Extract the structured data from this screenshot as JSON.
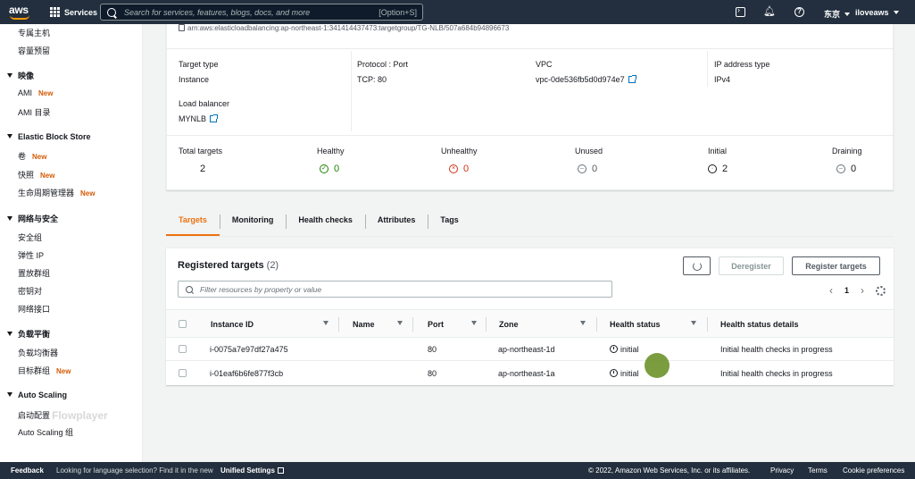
{
  "topnav": {
    "logo": "aws",
    "services": "Services",
    "search_placeholder": "Search for services, features, blogs, docs, and more",
    "search_shortcut": "[Option+S]",
    "region": "东京",
    "user": "iloveaws",
    "icons": [
      "cloudshell-icon",
      "bell-icon",
      "help-icon"
    ]
  },
  "sidebar": {
    "items": [
      {
        "label": "专属主机"
      },
      {
        "label": "容量预留"
      }
    ],
    "sections": [
      {
        "title": "映像",
        "items": [
          {
            "label": "AMI",
            "badge": "New"
          },
          {
            "label": "AMI 目录"
          }
        ]
      },
      {
        "title": "Elastic Block Store",
        "items": [
          {
            "label": "卷",
            "badge": "New"
          },
          {
            "label": "快照",
            "badge": "New"
          },
          {
            "label": "生命周期管理器",
            "badge": "New"
          }
        ]
      },
      {
        "title": "网络与安全",
        "items": [
          {
            "label": "安全组"
          },
          {
            "label": "弹性 IP"
          },
          {
            "label": "置放群组"
          },
          {
            "label": "密钥对"
          },
          {
            "label": "网络接口"
          }
        ]
      },
      {
        "title": "负载平衡",
        "items": [
          {
            "label": "负载均衡器"
          },
          {
            "label": "目标群组",
            "badge": "New"
          }
        ]
      },
      {
        "title": "Auto Scaling",
        "items": [
          {
            "label": "启动配置"
          },
          {
            "label": "Auto Scaling 组"
          }
        ]
      }
    ]
  },
  "details": {
    "arn": "arn:aws:elasticloadbalancing:ap-northeast-1:341414437473:targetgroup/TG-NLB/507a684b94896673",
    "target_type_label": "Target type",
    "target_type": "Instance",
    "protocol_label": "Protocol : Port",
    "protocol": "TCP: 80",
    "vpc_label": "VPC",
    "vpc": "vpc-0de536fb5d0d974e7",
    "ip_type_label": "IP address type",
    "ip_type": "IPv4",
    "lb_label": "Load balancer",
    "lb": "MYNLB"
  },
  "stats": [
    {
      "label": "Total targets",
      "value": "2",
      "icon": ""
    },
    {
      "label": "Healthy",
      "value": "0",
      "icon": "check-circle-icon"
    },
    {
      "label": "Unhealthy",
      "value": "0",
      "icon": "x-circle-icon"
    },
    {
      "label": "Unused",
      "value": "0",
      "icon": "minus-circle-icon"
    },
    {
      "label": "Initial",
      "value": "2",
      "icon": "clock-icon"
    },
    {
      "label": "Draining",
      "value": "0",
      "icon": "minus-circle-icon"
    }
  ],
  "tabs": [
    "Targets",
    "Monitoring",
    "Health checks",
    "Attributes",
    "Tags"
  ],
  "targets": {
    "title": "Registered targets",
    "count": "(2)",
    "deregister": "Deregister",
    "register": "Register targets",
    "filter_placeholder": "Filter resources by property or value",
    "page": "1",
    "columns": [
      "Instance ID",
      "Name",
      "Port",
      "Zone",
      "Health status",
      "Health status details"
    ],
    "rows": [
      {
        "id": "i-0075a7e97df27a475",
        "name": "",
        "port": "80",
        "zone": "ap-northeast-1d",
        "status": "initial",
        "details": "Initial health checks in progress"
      },
      {
        "id": "i-01eaf6b6fe877f3cb",
        "name": "",
        "port": "80",
        "zone": "ap-northeast-1a",
        "status": "initial",
        "details": "Initial health checks in progress"
      }
    ]
  },
  "watermark": "Flowplayer",
  "footer": {
    "feedback": "Feedback",
    "lang": "Looking for language selection? Find it in the new",
    "unified": "Unified Settings",
    "copyright": "© 2022, Amazon Web Services, Inc. or its affiliates.",
    "privacy": "Privacy",
    "terms": "Terms",
    "cookie": "Cookie preferences"
  }
}
